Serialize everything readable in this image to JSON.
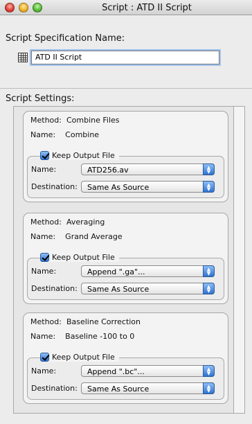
{
  "window": {
    "title": "Script : ATD II Script"
  },
  "spec": {
    "label": "Script Specification Name:",
    "value": "ATD II Script"
  },
  "settings": {
    "label": "Script Settings:",
    "keys": {
      "method": "Method:",
      "name": "Name:",
      "destination": "Destination:"
    },
    "steps": [
      {
        "method": "Combine Files",
        "name": "Combine",
        "keep_output_label": "Keep Output File",
        "output_name": "ATD256.av",
        "destination": "Same As Source"
      },
      {
        "method": "Averaging",
        "name": "Grand Average",
        "keep_output_label": "Keep Output File",
        "output_name": "Append \".ga\"...",
        "destination": "Same As Source"
      },
      {
        "method": "Baseline Correction",
        "name": "Baseline -100 to 0",
        "keep_output_label": "Keep Output File",
        "output_name": "Append \".bc\"...",
        "destination": "Same As Source"
      }
    ]
  }
}
